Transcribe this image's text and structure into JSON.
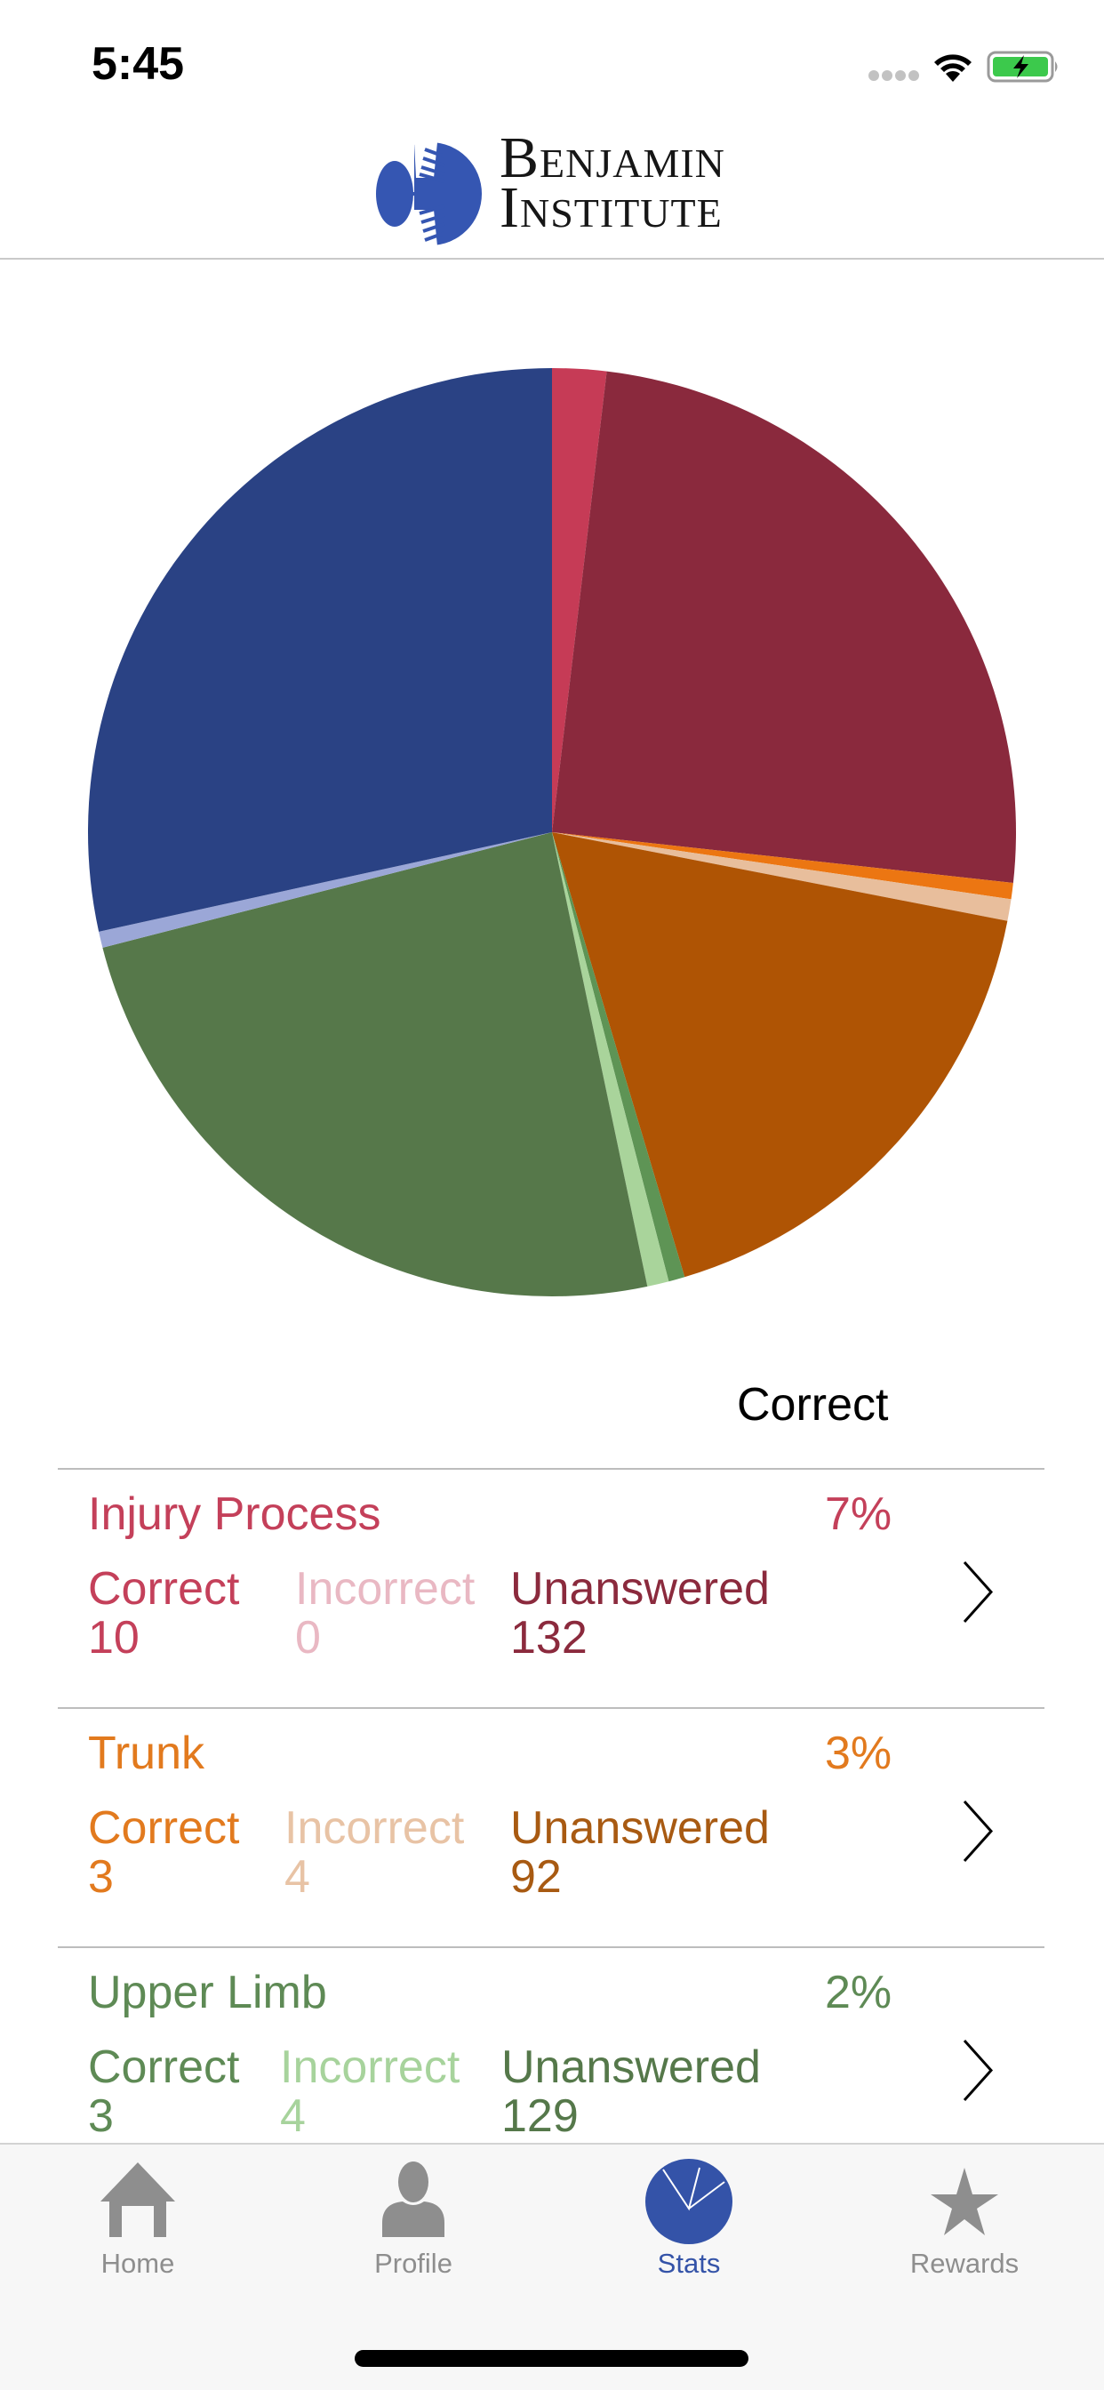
{
  "status_bar": {
    "time": "5:45"
  },
  "header": {
    "logo_line1": "Benjamin",
    "logo_line2": "Institute"
  },
  "chart_data": {
    "type": "pie",
    "title": "",
    "caption": "Correct",
    "start": "12 o'clock",
    "direction": "clockwise",
    "legend": "none",
    "slices": [
      {
        "category": "Injury Process",
        "status": "Correct",
        "value": 10,
        "color": "#C63B56"
      },
      {
        "category": "Injury Process",
        "status": "Incorrect",
        "value": 0,
        "color": "#E8B5C0"
      },
      {
        "category": "Injury Process",
        "status": "Unanswered",
        "value": 132,
        "color": "#8A293D"
      },
      {
        "category": "Trunk",
        "status": "Correct",
        "value": 3,
        "color": "#EC7612"
      },
      {
        "category": "Trunk",
        "status": "Incorrect",
        "value": 4,
        "color": "#E8BE9C"
      },
      {
        "category": "Trunk",
        "status": "Unanswered",
        "value": 92,
        "color": "#AF5404"
      },
      {
        "category": "Upper Limb",
        "status": "Correct",
        "value": 3,
        "color": "#5E9455"
      },
      {
        "category": "Upper Limb",
        "status": "Incorrect",
        "value": 4,
        "color": "#A9D49B"
      },
      {
        "category": "Upper Limb",
        "status": "Unanswered",
        "value": 129,
        "color": "#56784A"
      },
      {
        "category": "",
        "status": "Incorrect",
        "value": 3,
        "color": "#9BA7D7"
      },
      {
        "category": "",
        "status": "Unanswered",
        "value": 151,
        "color": "#2A4284"
      }
    ]
  },
  "stats_list": {
    "labels": {
      "correct": "Correct",
      "incorrect": "Incorrect",
      "unanswered": "Unanswered"
    },
    "rows": [
      {
        "title": "Injury Process",
        "percent": "7%",
        "correct": "10",
        "incorrect": "0",
        "unanswered": "132",
        "colors": {
          "main": "#C4405A",
          "light": "#E9B8C3",
          "dark": "#8B2A3D"
        }
      },
      {
        "title": "Trunk",
        "percent": "3%",
        "correct": "3",
        "incorrect": "4",
        "unanswered": "92",
        "colors": {
          "main": "#E27A1E",
          "light": "#E8C3A5",
          "dark": "#A85A12"
        }
      },
      {
        "title": "Upper Limb",
        "percent": "2%",
        "correct": "3",
        "incorrect": "4",
        "unanswered": "129",
        "colors": {
          "main": "#5E8A55",
          "light": "#A7D39C",
          "dark": "#55784A"
        }
      }
    ]
  },
  "tab_bar": {
    "active_color": "#3453A8",
    "inactive_color": "#8E8E8E",
    "tabs": [
      {
        "label": "Home",
        "icon": "home-icon"
      },
      {
        "label": "Profile",
        "icon": "person-icon"
      },
      {
        "label": "Stats",
        "icon": "pie-chart-icon",
        "active": true
      },
      {
        "label": "Rewards",
        "icon": "star-icon"
      }
    ]
  }
}
